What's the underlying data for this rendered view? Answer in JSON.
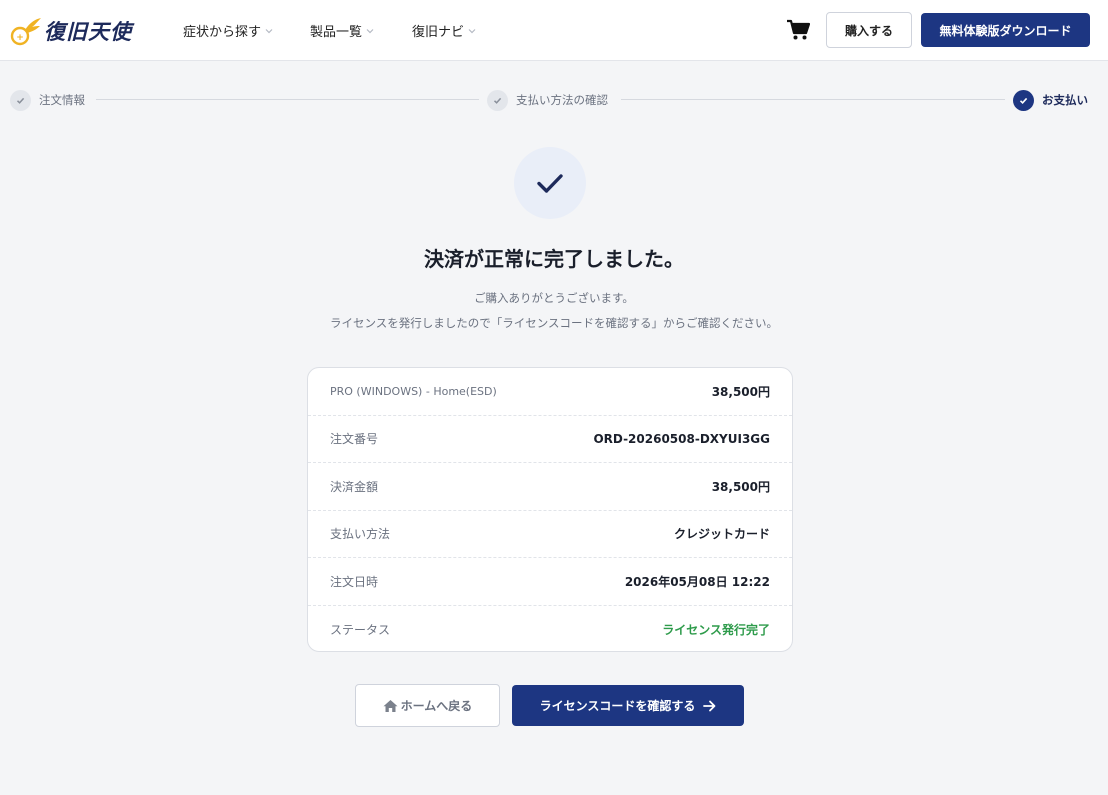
{
  "header": {
    "logo_text": "復旧天使",
    "logo_icon": "winged-coin-icon",
    "nav": [
      {
        "label": "症状から探す"
      },
      {
        "label": "製品一覧"
      },
      {
        "label": "復旧ナビ"
      }
    ],
    "cart_icon": "cart-icon",
    "buy_label": "購入する",
    "download_label": "無料体験版ダウンロード"
  },
  "stepper": {
    "steps": [
      {
        "label": "注文情報",
        "state": "done"
      },
      {
        "label": "支払い方法の確認",
        "state": "done"
      },
      {
        "label": "お支払い",
        "state": "active"
      }
    ]
  },
  "result": {
    "icon": "check-icon",
    "title": "決済が正常に完了しました。",
    "message_line1": "ご購入ありがとうございます。",
    "message_line2": "ライセンスを発行しましたので「ライセンスコードを確認する」からご確認ください。"
  },
  "order": {
    "rows": [
      {
        "label": "PRO (WINDOWS) - Home(ESD)",
        "value": "38,500円"
      },
      {
        "label": "注文番号",
        "value": "ORD-20260508-DXYUI3GG"
      },
      {
        "label": "決済金額",
        "value": "38,500円"
      },
      {
        "label": "支払い方法",
        "value": "クレジットカード"
      },
      {
        "label": "注文日時",
        "value": "2026年05月08日 12:22"
      },
      {
        "label": "ステータス",
        "value": "ライセンス発行完了"
      }
    ]
  },
  "actions": {
    "home_label": "ホームへ戻る",
    "license_label": "ライセンスコードを確認する"
  },
  "colors": {
    "primary": "#1d3682",
    "success": "#2e9b4b",
    "background": "#f4f5f7"
  }
}
